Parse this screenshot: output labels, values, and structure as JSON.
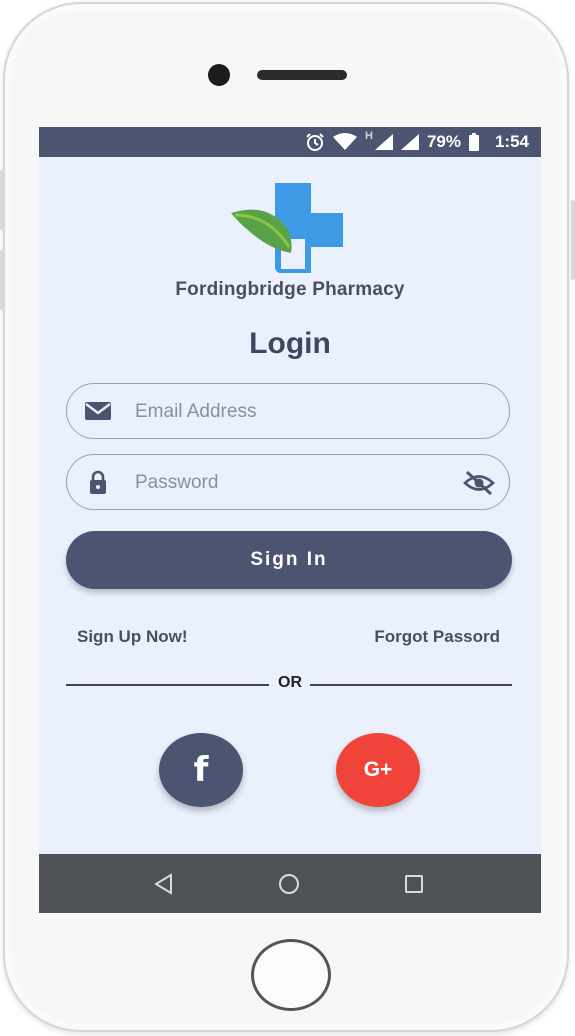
{
  "status_bar": {
    "battery": "79%",
    "time": "1:54",
    "network": "H"
  },
  "brand": {
    "name": "Fordingbridge Pharmacy"
  },
  "login": {
    "title": "Login",
    "email_placeholder": "Email Address",
    "email_value": "",
    "password_placeholder": "Password",
    "password_value": "",
    "sign_in_label": "Sign In",
    "sign_up_label": "Sign Up Now!",
    "forgot_label": "Forgot Passord",
    "or_label": "OR"
  },
  "social": {
    "facebook_glyph": "f",
    "google_glyph": "G+"
  },
  "icons": {
    "email": "envelope-icon",
    "password": "lock-icon",
    "toggle_visibility": "eye-off-icon",
    "nav_back": "triangle-back-icon",
    "nav_home": "circle-home-icon",
    "nav_recent": "square-recent-icon"
  },
  "colors": {
    "primary": "#4b5470",
    "google": "#f0443a",
    "screen_bg": "#eaf1fd",
    "logo_blue": "#3f9ae6",
    "logo_green": "#5aa24a"
  }
}
